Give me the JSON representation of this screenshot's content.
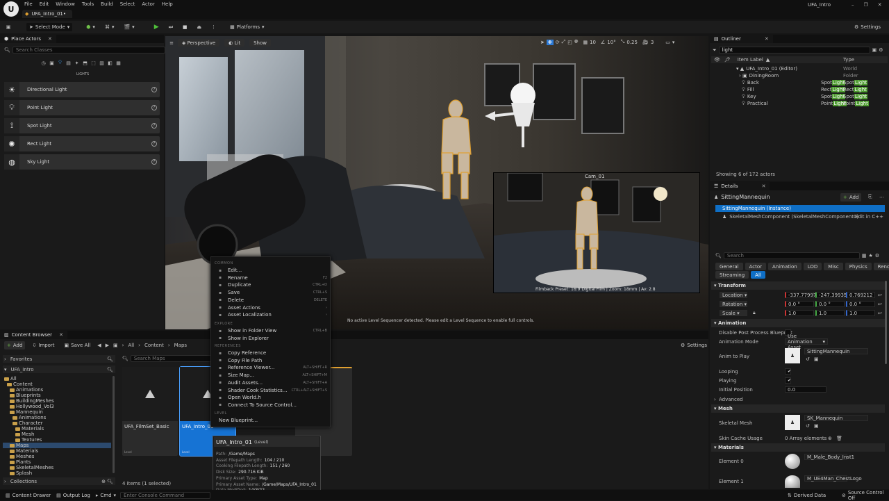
{
  "app": {
    "logo": "unreal-logo",
    "menu": [
      "File",
      "Edit",
      "Window",
      "Tools",
      "Build",
      "Select",
      "Actor",
      "Help"
    ],
    "level_tab": "UFA_Intro_01•",
    "window_title": "UFA_Intro"
  },
  "toolbar": {
    "select_mode": "Select Mode",
    "platforms": "Platforms",
    "settings": "Settings"
  },
  "place_actors": {
    "tab": "Place Actors",
    "search_placeholder": "Search Classes",
    "category": "LIGHTS",
    "items": [
      {
        "label": "Directional Light",
        "icon": "sun-icon"
      },
      {
        "label": "Point Light",
        "icon": "bulb-icon"
      },
      {
        "label": "Spot Light",
        "icon": "spotlight-icon"
      },
      {
        "label": "Rect Light",
        "icon": "rect-light-icon"
      },
      {
        "label": "Sky Light",
        "icon": "sky-light-icon"
      }
    ]
  },
  "viewport": {
    "perspective": "Perspective",
    "lit": "Lit",
    "show": "Show",
    "grid_value": "10",
    "angle_value": "10°",
    "scale_value": "0.25",
    "camera_speed": "3",
    "pip_label": "Cam_01",
    "pip_overlay": "Filmback Preset: 16:9 Digital Film | Zoom: 18mm | Av: 2.8",
    "sequencer_msg": "No active Level Sequencer detected. Please edit a Level Sequence to enable full controls."
  },
  "outliner": {
    "tab": "Outliner",
    "search": "light",
    "col_label": "Item Label",
    "col_type": "Type",
    "rows": [
      {
        "label": "UFA_Intro_01 (Editor)",
        "type": "World",
        "indent": 0
      },
      {
        "label": "DiningRoom",
        "type": "Folder",
        "indent": 1
      },
      {
        "label": "Back",
        "type_pre": "Spot",
        "type_hl": "Light",
        "type_post": "",
        "type2_pre": "Spot",
        "type2_hl": "Light",
        "indent": 2
      },
      {
        "label": "Fill",
        "type_pre": "Rect",
        "type_hl": "Light",
        "type2_pre": "Rect",
        "type2_hl": "Light",
        "indent": 2
      },
      {
        "label": "Key",
        "type_pre": "Spot",
        "type_hl": "Light",
        "type2_pre": "Spot",
        "type2_hl": "Light",
        "indent": 2
      },
      {
        "label": "Practical",
        "type_pre": "Point",
        "type_hl": "Light",
        "type2_pre": "Point",
        "type2_hl": "Light",
        "indent": 2
      }
    ],
    "footer": "Showing 6 of 172 actors"
  },
  "details": {
    "tab": "Details",
    "actor_name": "SittingMannequin",
    "add_label": "Add",
    "instance": "SittingMannequin (Instance)",
    "component": "SkeletalMeshComponent (SkeletalMeshComponent0)",
    "edit_cpp": "Edit in C++",
    "search_placeholder": "Search",
    "filters": [
      "General",
      "Actor",
      "Animation",
      "LOD",
      "Misc",
      "Physics",
      "Rendering"
    ],
    "filters2": [
      "Streaming",
      "All"
    ],
    "transform_section": "Transform",
    "location_label": "Location",
    "rotation_label": "Rotation",
    "scale_label": "Scale",
    "location": [
      "-337.779973",
      "-247.399358",
      "0.769212"
    ],
    "rotation": [
      "0.0 °",
      "0.0 °",
      "0.0 °"
    ],
    "scale": [
      "1.0",
      "1.0",
      "1.0"
    ],
    "animation_section": "Animation",
    "disable_pp": "Disable Post Process Blueprint",
    "anim_mode_label": "Animation Mode",
    "anim_mode": "Use Animation Asset",
    "anim_to_play_label": "Anim to Play",
    "anim_to_play": "SittingMannequin",
    "looping": "Looping",
    "playing": "Playing",
    "initial_pos_label": "Initial Position",
    "initial_pos": "0.0",
    "advanced": "Advanced",
    "mesh_section": "Mesh",
    "skeletal_mesh_label": "Skeletal Mesh",
    "skeletal_mesh": "SK_Mannequin",
    "skin_cache": "Skin Cache Usage",
    "array_elements": "0 Array elements",
    "materials_section": "Materials",
    "element0": "Element 0",
    "element0_val": "M_Male_Body_Inst1",
    "element1": "Element 1",
    "element1_val": "M_UE4Man_ChestLogo"
  },
  "content_browser": {
    "tab": "Content Browser",
    "add": "Add",
    "import": "Import",
    "save_all": "Save All",
    "path": [
      "All",
      "Content",
      "Maps"
    ],
    "settings": "Settings",
    "favorites": "Favorites",
    "project": "UFA_Intro",
    "search_placeholder": "Search Maps",
    "tree": [
      {
        "label": "All",
        "depth": 0
      },
      {
        "label": "Content",
        "depth": 1
      },
      {
        "label": "Animations",
        "depth": 2
      },
      {
        "label": "Blueprints",
        "depth": 2
      },
      {
        "label": "BuildingMeshes",
        "depth": 2
      },
      {
        "label": "Hollywood_Vol3",
        "depth": 2
      },
      {
        "label": "Mannequin",
        "depth": 2
      },
      {
        "label": "Animations",
        "depth": 3
      },
      {
        "label": "Character",
        "depth": 3
      },
      {
        "label": "Materials",
        "depth": 4
      },
      {
        "label": "Mesh",
        "depth": 4
      },
      {
        "label": "Textures",
        "depth": 4
      },
      {
        "label": "Maps",
        "depth": 2
      },
      {
        "label": "Materials",
        "depth": 2
      },
      {
        "label": "Meshes",
        "depth": 2
      },
      {
        "label": "Plants",
        "depth": 2
      },
      {
        "label": "SkeletalMeshes",
        "depth": 2
      },
      {
        "label": "Splash",
        "depth": 2
      }
    ],
    "collections": "Collections",
    "status": "4 items (1 selected)",
    "assets": [
      {
        "name": "UFA_FilmSet_Basic",
        "type": "Level"
      },
      {
        "name": "UFA_Intro_01",
        "type": "Level"
      }
    ]
  },
  "context_menu": {
    "common": "COMMON",
    "items_common": [
      {
        "label": "Edit...",
        "key": ""
      },
      {
        "label": "Rename",
        "key": "F2"
      },
      {
        "label": "Duplicate",
        "key": "CTRL+D"
      },
      {
        "label": "Save",
        "key": "CTRL+S"
      },
      {
        "label": "Delete",
        "key": "DELETE"
      },
      {
        "label": "Asset Actions",
        "key": "›"
      },
      {
        "label": "Asset Localization",
        "key": "›"
      }
    ],
    "explore": "EXPLORE",
    "items_explore": [
      {
        "label": "Show in Folder View",
        "key": "CTRL+B"
      },
      {
        "label": "Show in Explorer",
        "key": ""
      }
    ],
    "references": "REFERENCES",
    "items_ref": [
      {
        "label": "Copy Reference",
        "key": ""
      },
      {
        "label": "Copy File Path",
        "key": ""
      },
      {
        "label": "Reference Viewer...",
        "key": "ALT+SHIFT+R"
      },
      {
        "label": "Size Map...",
        "key": "ALT+SHIFT+M"
      },
      {
        "label": "Audit Assets...",
        "key": "ALT+SHIFT+A"
      },
      {
        "label": "Shader Cook Statistics...",
        "key": "CTRL+ALT+SHIFT+S"
      },
      {
        "label": "Open World.h",
        "key": ""
      },
      {
        "label": "Connect To Source Control...",
        "key": ""
      }
    ],
    "level": "LEVEL",
    "new_blueprint": "New Blueprint..."
  },
  "tooltip": {
    "title": "UFA_Intro_01",
    "title_type": "(Level)",
    "rows": [
      {
        "k": "Path:",
        "v": "/Game/Maps"
      },
      {
        "k": "Asset Filepath Length:",
        "v": "104 / 210"
      },
      {
        "k": "Cooking Filepath Length:",
        "v": "151 / 260"
      },
      {
        "k": "Disk Size:",
        "v": "290.716 KiB"
      },
      {
        "k": "Primary Asset Type:",
        "v": "Map"
      },
      {
        "k": "Primary Asset Name:",
        "v": "/Game/Maps/UFA_Intro_01"
      },
      {
        "k": "Date Modified:",
        "v": "14/3/22"
      }
    ]
  },
  "statusbar": {
    "content_drawer": "Content Drawer",
    "output_log": "Output Log",
    "cmd": "Cmd",
    "console_placeholder": "Enter Console Command",
    "derived_data": "Derived Data",
    "source_control": "Source Control Off"
  }
}
